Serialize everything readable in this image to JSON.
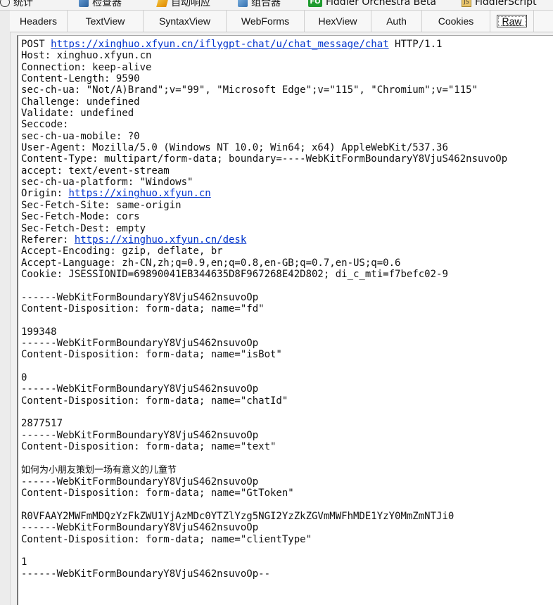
{
  "top_tabs": [
    {
      "label": "统计",
      "icon": "stats-icon"
    },
    {
      "label": "检查器",
      "icon": "inspector-icon"
    },
    {
      "label": "自动响应",
      "icon": "autoresponder-icon"
    },
    {
      "label": "组合器",
      "icon": "composer-icon"
    },
    {
      "label": "Fiddler Orchestra Beta",
      "icon": "fo-icon",
      "icon_text": "FO"
    },
    {
      "label": "FiddlerScript",
      "icon": "js-icon",
      "icon_text": "JS"
    }
  ],
  "sub_tabs": [
    "Headers",
    "TextView",
    "SyntaxView",
    "WebForms",
    "HexView",
    "Auth",
    "Cookies",
    "Raw"
  ],
  "active_sub_tab": "Raw",
  "raw": {
    "method": "POST ",
    "url": "https://xinghuo.xfyun.cn/iflygpt-chat/u/chat_message/chat",
    "protocol": " HTTP/1.1",
    "host": "Host: xinghuo.xfyun.cn",
    "connection": "Connection: keep-alive",
    "content_length": "Content-Length: 9590",
    "sec_ch_ua": "sec-ch-ua: \"Not/A)Brand\";v=\"99\", \"Microsoft Edge\";v=\"115\", \"Chromium\";v=\"115\"",
    "challenge": "Challenge: undefined",
    "validate": "Validate: undefined",
    "seccode": "Seccode:",
    "sec_ch_ua_mobile": "sec-ch-ua-mobile: ?0",
    "user_agent": "User-Agent: Mozilla/5.0 (Windows NT 10.0; Win64; x64) AppleWebKit/537.36",
    "content_type": "Content-Type: multipart/form-data; boundary=----WebKitFormBoundaryY8VjuS462nsuvoOp",
    "accept": "accept: text/event-stream",
    "sec_ch_ua_platform": "sec-ch-ua-platform: \"Windows\"",
    "origin_label": "Origin: ",
    "origin_url": "https://xinghuo.xfyun.cn",
    "sec_fetch_site": "Sec-Fetch-Site: same-origin",
    "sec_fetch_mode": "Sec-Fetch-Mode: cors",
    "sec_fetch_dest": "Sec-Fetch-Dest: empty",
    "referer_label": "Referer: ",
    "referer_url": "https://xinghuo.xfyun.cn/desk",
    "accept_encoding": "Accept-Encoding: gzip, deflate, br",
    "accept_language": "Accept-Language: zh-CN,zh;q=0.9,en;q=0.8,en-GB;q=0.7,en-US;q=0.6",
    "cookie": "Cookie: JSESSIONID=69890041EB344635D8F967268E42D802; di_c_mti=f7befc02-9",
    "boundary": "------WebKitFormBoundaryY8VjuS462nsuvoOp",
    "cd_fd": "Content-Disposition: form-data; name=\"fd\"",
    "val_fd": "199348",
    "cd_isbot": "Content-Disposition: form-data; name=\"isBot\"",
    "val_isbot": "0",
    "cd_chatid": "Content-Disposition: form-data; name=\"chatId\"",
    "val_chatid": "2877517",
    "cd_text": "Content-Disposition: form-data; name=\"text\"",
    "val_text": "如何为小朋友策划一场有意义的儿童节",
    "cd_gttoken": "Content-Disposition: form-data; name=\"GtToken\"",
    "val_gttoken": "R0VFAAY2MWFmMDQzYzFkZWU1YjAzMDc0YTZlYzg5NGI2YzZkZGVmMWFhMDE1YzY0MmZmNTJi0",
    "cd_clienttype": "Content-Disposition: form-data; name=\"clientType\"",
    "val_clienttype": "1",
    "boundary_end": "------WebKitFormBoundaryY8VjuS462nsuvoOp--"
  }
}
